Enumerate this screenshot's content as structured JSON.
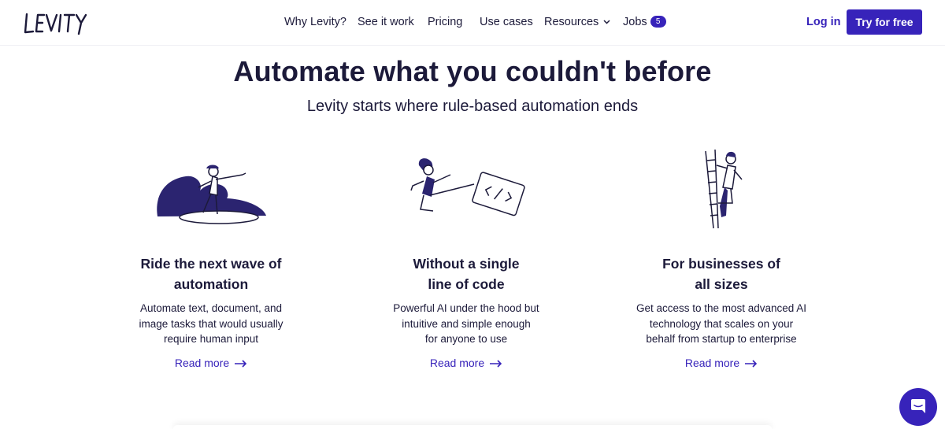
{
  "brand": {
    "logo_text": "LEVITY",
    "accent": "#3723ba"
  },
  "nav": {
    "items": [
      {
        "label": "Why Levity?"
      },
      {
        "label": "See it work"
      },
      {
        "label": "Pricing"
      },
      {
        "label": "Use cases"
      },
      {
        "label": "Resources"
      },
      {
        "label": "Jobs"
      }
    ],
    "jobs_badge": "5",
    "login": "Log in",
    "cta": "Try for free"
  },
  "hero": {
    "title": "Automate what you couldn't before",
    "subtitle": "Levity starts where rule-based automation ends"
  },
  "features": [
    {
      "title_lines": [
        "Ride the next wave of",
        "automation"
      ],
      "desc_lines": [
        "Automate text, document, and",
        "image tasks that would usually",
        "require human input"
      ],
      "link": "Read more",
      "illustration": "surfer-illustration"
    },
    {
      "title_lines": [
        "Without a single",
        "line of code"
      ],
      "desc_lines": [
        "Powerful AI under the hood but",
        "intuitive and simple enough",
        "for anyone to use"
      ],
      "link": "Read more",
      "illustration": "kick-code-illustration"
    },
    {
      "title_lines": [
        "For businesses of",
        "all sizes"
      ],
      "desc_lines": [
        "Get access to the most advanced AI",
        "technology that scales on your",
        "behalf from startup to enterprise"
      ],
      "link": "Read more",
      "illustration": "climber-illustration"
    }
  ],
  "chat": {
    "icon": "chat-icon"
  }
}
